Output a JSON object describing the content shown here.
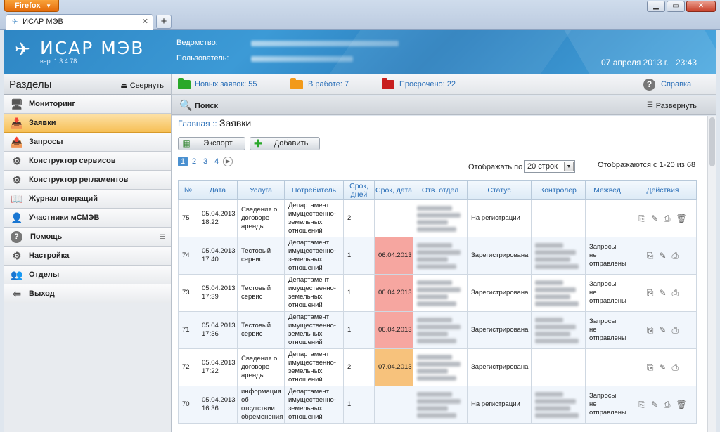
{
  "browser": {
    "button_label": "Firefox",
    "tab_title": "ИСАР МЭВ",
    "new_tab": "+",
    "minimize": "▁",
    "maximize": "▭",
    "close": "✕"
  },
  "header": {
    "app_name": "ИСАР МЭВ",
    "version": "вер. 1.3.4.78",
    "department_label": "Ведомство:",
    "user_label": "Пользователь:",
    "date": "07 апреля 2013 г.",
    "time": "23:43"
  },
  "sidebar": {
    "title": "Разделы",
    "collapse_label": "Свернуть",
    "items": [
      {
        "label": "Мониторинг",
        "icon": "monitor-icon",
        "active": false
      },
      {
        "label": "Заявки",
        "icon": "inbox-icon",
        "active": true
      },
      {
        "label": "Запросы",
        "icon": "outbox-icon",
        "active": false
      },
      {
        "label": "Конструктор сервисов",
        "icon": "gear-icon",
        "active": false
      },
      {
        "label": "Конструктор регламентов",
        "icon": "gear-icon",
        "active": false
      },
      {
        "label": "Журнал операций",
        "icon": "book-icon",
        "active": false
      },
      {
        "label": "Участники мСМЭВ",
        "icon": "user-icon",
        "active": false
      },
      {
        "label": "Помощь",
        "icon": "help-icon",
        "active": false
      },
      {
        "label": "Настройка",
        "icon": "gears-icon",
        "active": false
      },
      {
        "label": "Отделы",
        "icon": "group-icon",
        "active": false
      },
      {
        "label": "Выход",
        "icon": "exit-icon",
        "active": false
      }
    ]
  },
  "status": {
    "new_label": "Новых заявок: 55",
    "in_work_label": "В работе: 7",
    "overdue_label": "Просрочено: 22",
    "help_label": "Справка",
    "colors": {
      "new": "#2aa82a",
      "in_work": "#f29a1a",
      "overdue": "#c81e1e"
    }
  },
  "search": {
    "label": "Поиск",
    "expand_label": "Развернуть"
  },
  "main": {
    "breadcrumb_home": "Главная ::",
    "breadcrumb_current": "Заявки",
    "export_label": "Экспорт",
    "add_label": "Добавить",
    "pages": [
      "1",
      "2",
      "3",
      "4"
    ],
    "per_page_label": "Отображать по",
    "per_page_value": "20 строк",
    "showing_label": "Отображаются с 1-20 из 68"
  },
  "table": {
    "columns": [
      "№",
      "Дата",
      "Услуга",
      "Потребитель",
      "Срок, дней",
      "Срок, дата",
      "Отв. отдел",
      "Статус",
      "Контролер",
      "Межвед",
      "Действия"
    ],
    "rows": [
      {
        "num": "75",
        "date": "05.04.2013 18:22",
        "service": "Сведения о договоре аренды",
        "consumer": "Департамент имущественно-земельных отношений",
        "days": "2",
        "due": "",
        "due_color": "",
        "status": "На регистрации",
        "controller": false,
        "interdept": "",
        "actions": 4
      },
      {
        "num": "74",
        "date": "05.04.2013 17:40",
        "service": "Тестовый сервис",
        "consumer": "Департамент имущественно-земельных отношений",
        "days": "1",
        "due": "06.04.2013",
        "due_color": "red",
        "status": "Зарегистрирована",
        "controller": true,
        "interdept": "Запросы не отправлены",
        "actions": 3
      },
      {
        "num": "73",
        "date": "05.04.2013 17:39",
        "service": "Тестовый сервис",
        "consumer": "Департамент имущественно-земельных отношений",
        "days": "1",
        "due": "06.04.2013",
        "due_color": "red",
        "status": "Зарегистрирована",
        "controller": true,
        "interdept": "Запросы не отправлены",
        "actions": 3
      },
      {
        "num": "71",
        "date": "05.04.2013 17:36",
        "service": "Тестовый сервис",
        "consumer": "Департамент имущественно-земельных отношений",
        "days": "1",
        "due": "06.04.2013",
        "due_color": "red",
        "status": "Зарегистрирована",
        "controller": true,
        "interdept": "Запросы не отправлены",
        "actions": 3
      },
      {
        "num": "72",
        "date": "05.04.2013 17:22",
        "service": "Сведения о договоре аренды",
        "consumer": "Департамент имущественно-земельных отношений",
        "days": "2",
        "due": "07.04.2013",
        "due_color": "orange",
        "status": "Зарегистрирована",
        "controller": false,
        "interdept": "",
        "actions": 3
      },
      {
        "num": "70",
        "date": "05.04.2013 16:36",
        "service": "информация об отсутствии обременения",
        "consumer": "Департамент имущественно-земельных отношений",
        "days": "1",
        "due": "",
        "due_color": "",
        "status": "На регистрации",
        "controller": true,
        "interdept": "Запросы не отправлены",
        "actions": 4
      }
    ]
  }
}
